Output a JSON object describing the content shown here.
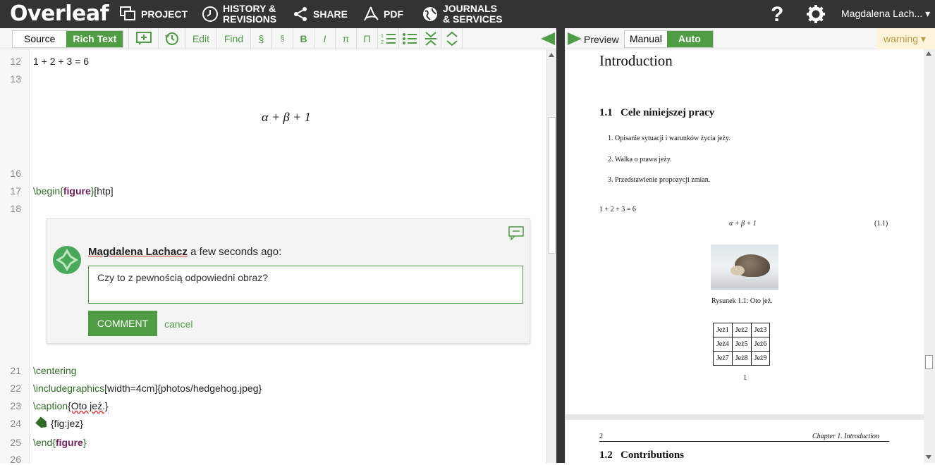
{
  "topbar": {
    "logo": "Overleaf",
    "nav": [
      {
        "label": "PROJECT",
        "icon": "project-icon"
      },
      {
        "label": "HISTORY &\nREVISIONS",
        "icon": "history-icon"
      },
      {
        "label": "SHARE",
        "icon": "share-icon"
      },
      {
        "label": "PDF",
        "icon": "pdf-icon"
      },
      {
        "label": "JOURNALS\n& SERVICES",
        "icon": "globe-icon"
      }
    ],
    "help": "?",
    "user": "Magdalena Lach... ▾"
  },
  "toolbar": {
    "source": "Source",
    "rich_text": "Rich Text",
    "edit": "Edit",
    "find": "Find",
    "section": "§",
    "subsection": "§",
    "bold": "B",
    "italic": "I",
    "math_inline": "π",
    "math_display": "Π",
    "preview": "Preview",
    "manual": "Manual",
    "auto": "Auto",
    "warning": "warning ▾"
  },
  "editor": {
    "lines": [
      {
        "n": "12",
        "text": "1 + 2 + 3 = 6"
      },
      {
        "n": "13",
        "text": ""
      },
      {
        "n": "16",
        "text": ""
      },
      {
        "n": "17",
        "cmd": "\\begin",
        "arg": "figure",
        "rest": "[htp]"
      },
      {
        "n": "18",
        "text": ""
      },
      {
        "n": "21",
        "cmd": "\\centering"
      },
      {
        "n": "22",
        "cmd": "\\includegraphics",
        "rest": "[width=4cm]{photos/hedgehog.jpeg}"
      },
      {
        "n": "23",
        "cmd": "\\caption",
        "rest": "{Oto jeż.}"
      },
      {
        "n": "24",
        "rest": "{fig:jez}"
      },
      {
        "n": "25",
        "cmd": "\\end",
        "arg": "figure"
      },
      {
        "n": "26",
        "text": ""
      }
    ],
    "math": "α + β + 1"
  },
  "comment": {
    "author": "Magdalena Lachacz",
    "time": "a few seconds ago:",
    "text": "Czy to z pewnością odpowiedni obraz?",
    "submit": "COMMENT",
    "cancel": "cancel"
  },
  "pdf": {
    "chapter": "Introduction",
    "section": "1.1   Cele niniejszej pracy",
    "items": [
      "1.  Opisanie sytuacji i warunków życia jeży.",
      "2.  Walka o prawa jeży.",
      "3.  Przedstawienie propozycji zmian."
    ],
    "eq_text": "1 + 2 + 3 = 6",
    "eq_display": "α + β + 1",
    "eq_number": "(1.1)",
    "caption": "Rysunek 1.1: Oto jeż.",
    "table": [
      [
        "Jeż1",
        "Jeż2",
        "Jeż3"
      ],
      [
        "Jeż4",
        "Jeż5",
        "Jeż6"
      ],
      [
        "Jeż7",
        "Jeż8",
        "Jeż9"
      ]
    ],
    "page_num": "1",
    "page2_num": "2",
    "page2_header": "Chapter 1.  Introduction",
    "page2_section": "1.2   Contributions"
  },
  "colors": {
    "accent": "#4f9c45",
    "topbar": "#333333"
  }
}
